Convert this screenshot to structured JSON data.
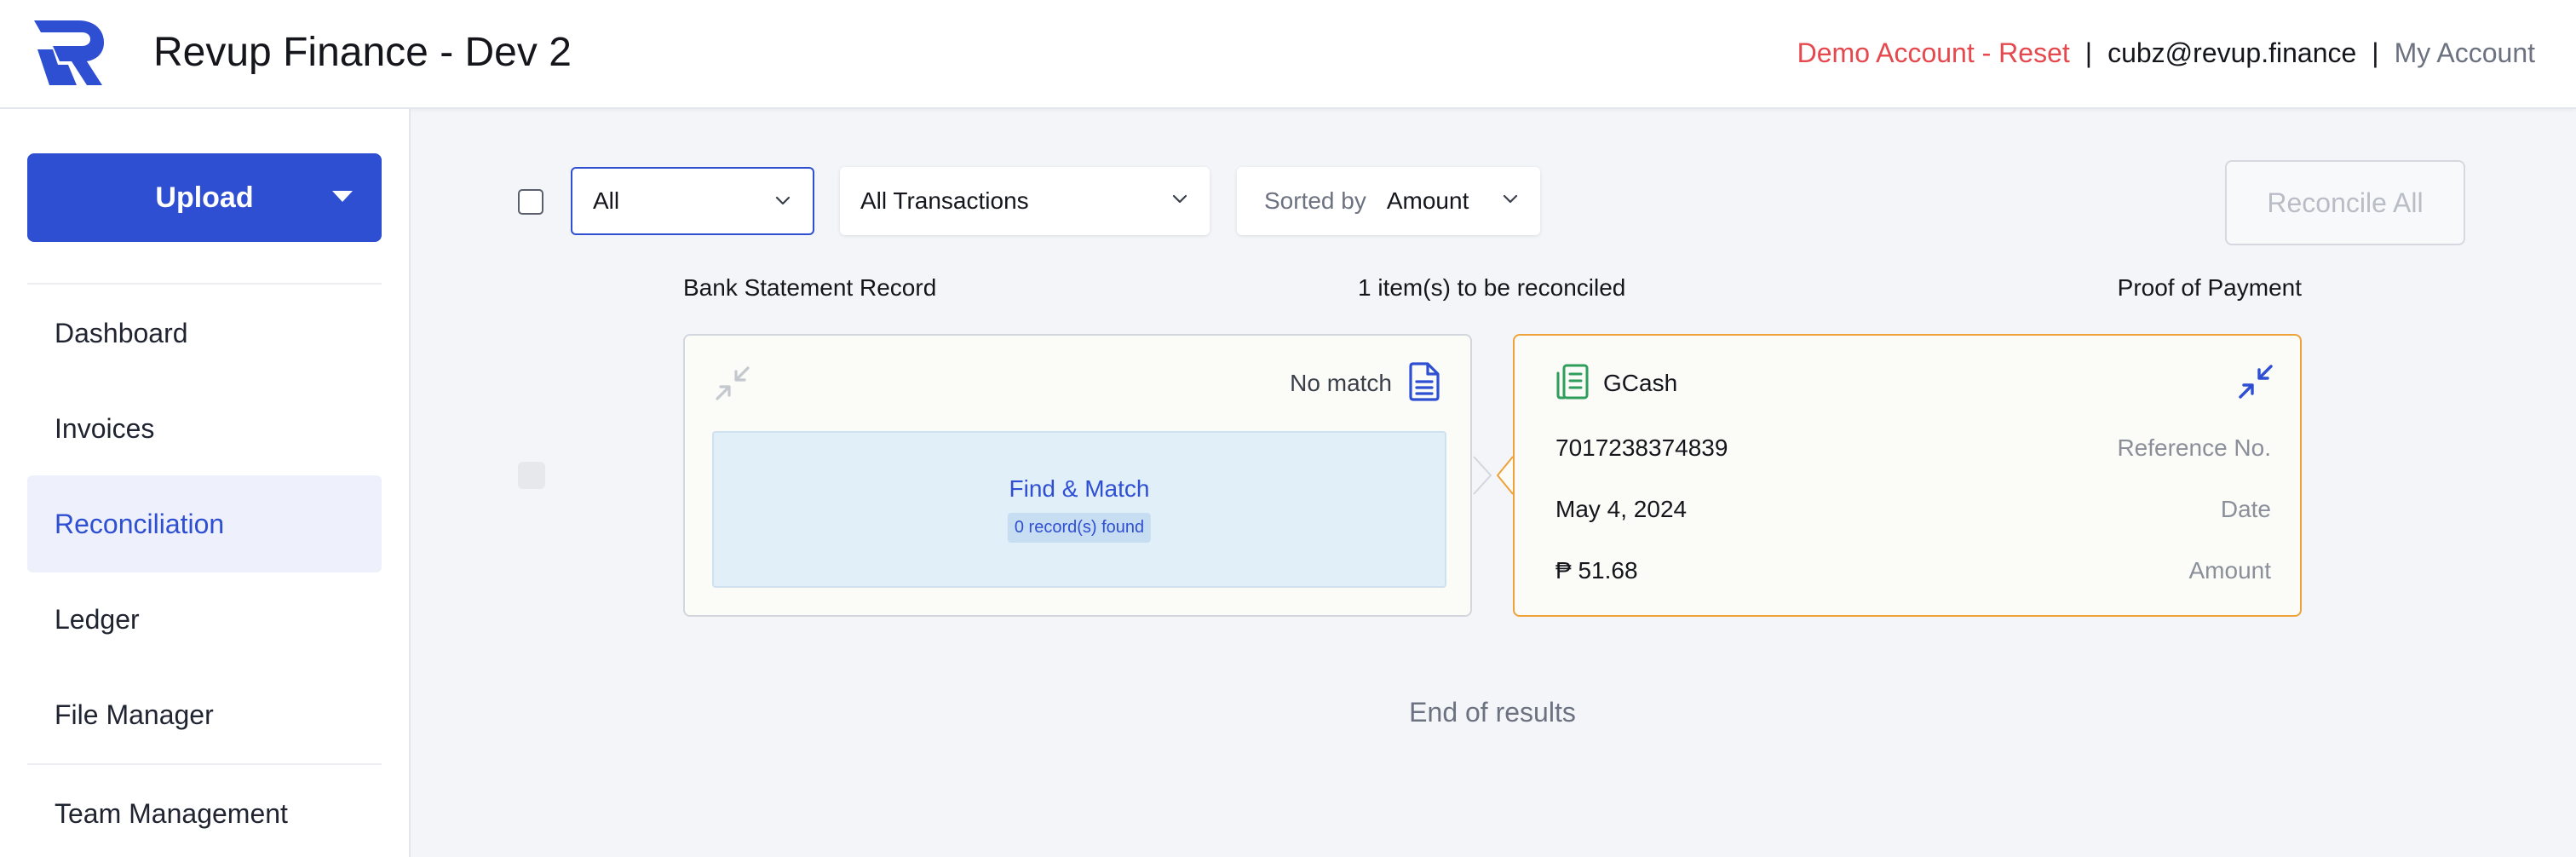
{
  "header": {
    "app_title": "Revup Finance - Dev 2",
    "demo_link": "Demo Account - Reset",
    "separator": "|",
    "email": "cubz@revup.finance",
    "account_link": "My Account"
  },
  "sidebar": {
    "upload_label": "Upload",
    "items": [
      {
        "label": "Dashboard"
      },
      {
        "label": "Invoices"
      },
      {
        "label": "Reconciliation"
      },
      {
        "label": "Ledger"
      },
      {
        "label": "File Manager"
      },
      {
        "label": "Team Management"
      }
    ]
  },
  "toolbar": {
    "status_filter": "All",
    "type_filter": "All Transactions",
    "sort_prefix": "Sorted by",
    "sort_value": "Amount",
    "reconcile_all_label": "Reconcile All"
  },
  "columns": {
    "left": "Bank Statement Record",
    "center": "1 item(s) to be reconciled",
    "right": "Proof of Payment"
  },
  "bank_card": {
    "status": "No match",
    "find_title": "Find & Match",
    "records_found": "0 record(s) found"
  },
  "payment_card": {
    "method": "GCash",
    "reference_value": "7017238374839",
    "reference_label": "Reference No.",
    "date_value": "May 4, 2024",
    "date_label": "Date",
    "amount_value": "₱ 51.68",
    "amount_label": "Amount"
  },
  "end_of_results": "End of results",
  "colors": {
    "brand_blue": "#2f4fd3",
    "demo_red": "#e5484d",
    "card_orange_border": "#f0a23a",
    "gcash_green": "#2e9e5a"
  },
  "icons": {
    "logo": "revup-logo",
    "upload_menu": "caret-down-icon",
    "select": "chevron-down-icon",
    "bank_collapse": "collapse-arrows-icon",
    "no_match": "document-icon",
    "gcash": "receipt-icon",
    "payment_collapse": "collapse-arrows-icon"
  }
}
